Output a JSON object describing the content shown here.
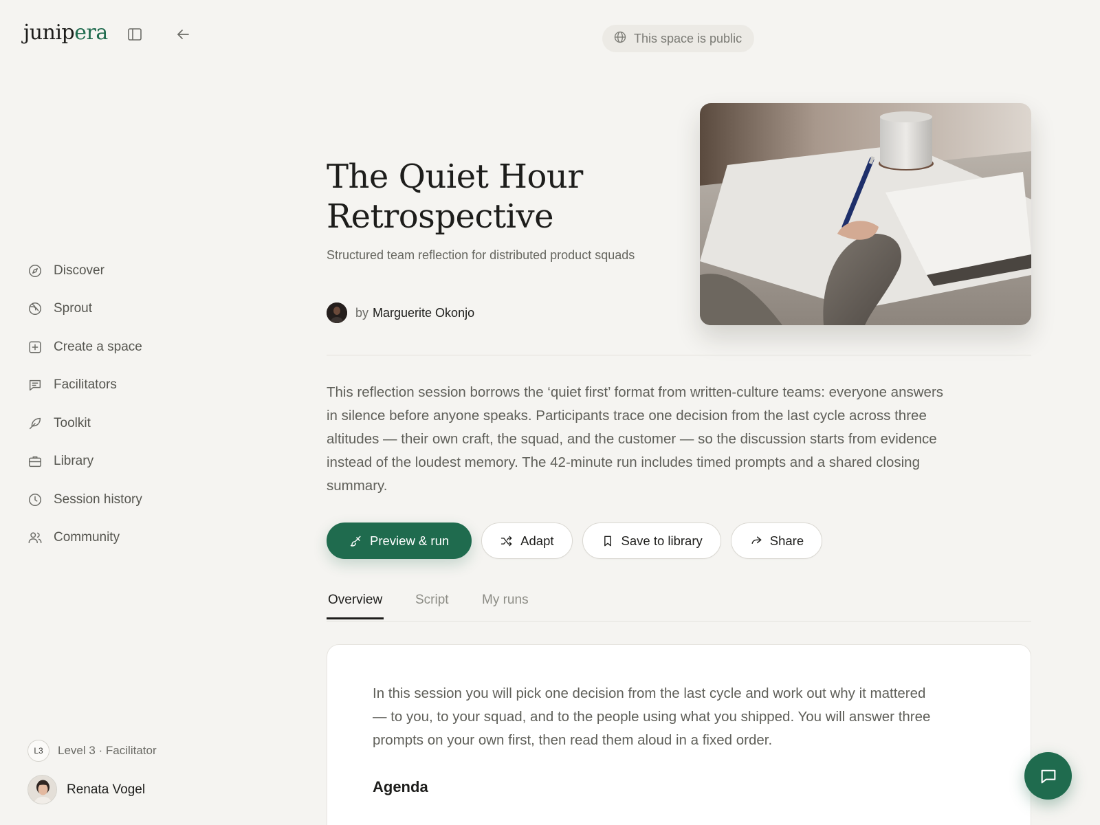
{
  "brand": {
    "name_part1": "junip",
    "name_part2": "era",
    "accent_color": "#1f6b4e"
  },
  "header": {
    "visibility_label": "This space is public"
  },
  "sidebar": {
    "items": [
      {
        "label": "Discover",
        "icon": "compass-icon"
      },
      {
        "label": "Sprout",
        "icon": "sprout-icon"
      },
      {
        "label": "Create a space",
        "icon": "plus-square-icon"
      },
      {
        "label": "Facilitators",
        "icon": "message-square-icon"
      },
      {
        "label": "Toolkit",
        "icon": "feather-icon"
      },
      {
        "label": "Library",
        "icon": "briefcase-icon"
      },
      {
        "label": "Session history",
        "icon": "clock-icon"
      },
      {
        "label": "Community",
        "icon": "users-icon"
      }
    ],
    "level_badge": "L3",
    "level_label": "Level 3 · Facilitator",
    "user_name": "Renata Vogel"
  },
  "space": {
    "title": "The Quiet Hour Retrospective",
    "subtitle": "Structured team reflection for distributed product squads",
    "author_prefix": "by",
    "author_name": "Marguerite Okonjo",
    "description": "This reflection session borrows the ‘quiet first’ format from written-culture teams: everyone answers in silence before anyone speaks. Participants trace one decision from the last cycle across three altitudes — their own craft, the squad, and the customer — so the discussion starts from evidence instead of the loudest memory. The 42-minute run includes timed prompts and a shared closing summary."
  },
  "actions": {
    "preview_run": "Preview & run",
    "adapt": "Adapt",
    "save_to_library": "Save to library",
    "share": "Share"
  },
  "tabs": [
    {
      "label": "Overview",
      "active": true
    },
    {
      "label": "Script",
      "active": false
    },
    {
      "label": "My runs",
      "active": false
    }
  ],
  "overview": {
    "intro": "In this session you will pick one decision from the last cycle and work out why it mattered — to you, to your squad, and to the people using what you shipped. You will answer three prompts on your own first, then read them aloud in a fixed order.",
    "agenda_heading": "Agenda"
  }
}
